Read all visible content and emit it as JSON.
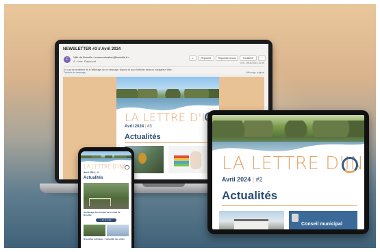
{
  "email": {
    "subject": "NEWSLETTER #3 // Avril 2024",
    "avatar_letter": "C",
    "from": "Ville de Bonville <communication@bonville.fr>",
    "to": "À : Vale. Raymond",
    "actions": [
      "Répondre",
      "Répondre à tous",
      "Transférer",
      "···"
    ],
    "date": "ven. 19/04/2024 10:05",
    "info": "En cas de problème lié à l'affichage de ce message, cliquez ici pour l'afficher dans un navigateur Web.",
    "toolbar_left": "Traduire le message",
    "toolbar_right": "Affichage original"
  },
  "newsletter": {
    "title": "LA LETTRE D'INF",
    "month": "Avril 2024",
    "sep": "|",
    "num_laptop": "#3",
    "num_tablet": "#2",
    "section": "Actualités",
    "card_caption": "Conseil municipal",
    "phone_caption_1": "Démarrage des travaux de la route de Bonville",
    "phone_caption_2": "Nouvelles rubriques : l'actualité des clubs",
    "phone_button": "Lire la suite"
  },
  "colors": {
    "accent_orange": "#e6a566",
    "brand_blue": "#2b4c72",
    "background_top": "#e9c79c",
    "background_bottom": "#3f6178"
  }
}
